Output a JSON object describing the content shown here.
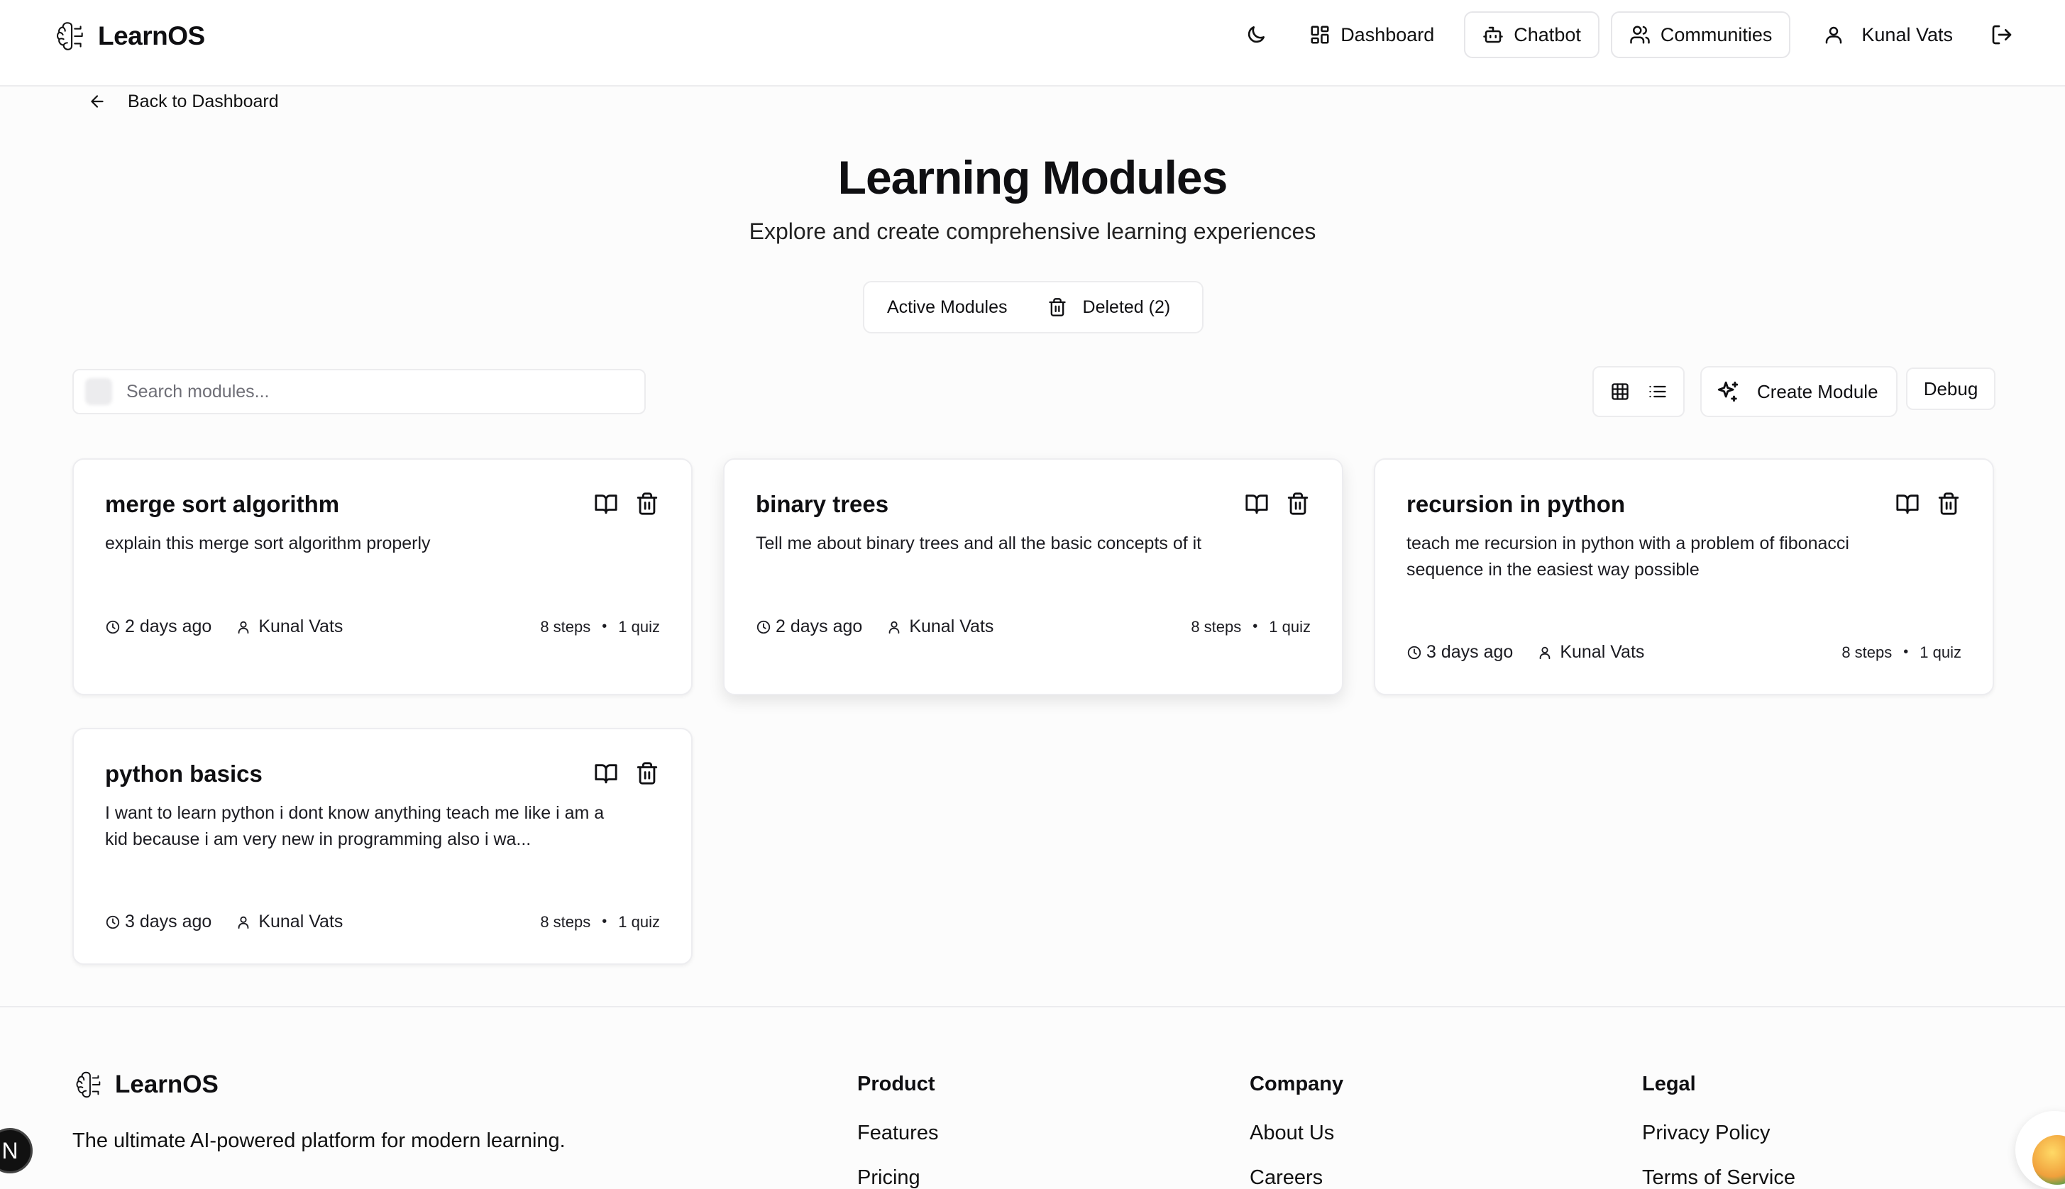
{
  "header": {
    "brand": "LearnOS",
    "nav": {
      "dashboard": "Dashboard",
      "chatbot": "Chatbot",
      "communities": "Communities",
      "user_name": "Kunal Vats"
    }
  },
  "back_link": "Back to Dashboard",
  "hero": {
    "title": "Learning Modules",
    "subtitle": "Explore and create comprehensive learning experiences"
  },
  "tabs": {
    "active": "Active Modules",
    "deleted": "Deleted (2)"
  },
  "toolbar": {
    "search_placeholder": "Search modules...",
    "create_label": "Create Module",
    "debug_label": "Debug"
  },
  "modules": [
    {
      "title": "merge sort algorithm",
      "description": "explain this merge sort algorithm properly",
      "time": "2 days ago",
      "author": "Kunal Vats",
      "steps": "8 steps",
      "quiz": "1 quiz"
    },
    {
      "title": "binary trees",
      "description": "Tell me about binary trees and all the basic concepts of it",
      "time": "2 days ago",
      "author": "Kunal Vats",
      "steps": "8 steps",
      "quiz": "1 quiz"
    },
    {
      "title": "recursion in python",
      "description": "teach me recursion in python with a problem of fibonacci sequence in the easiest way possible",
      "time": "3 days ago",
      "author": "Kunal Vats",
      "steps": "8 steps",
      "quiz": "1 quiz"
    },
    {
      "title": "python basics",
      "description": "I want to learn python i dont know anything teach me like i am a kid because i am very new in programming also i wa...",
      "time": "3 days ago",
      "author": "Kunal Vats",
      "steps": "8 steps",
      "quiz": "1 quiz"
    }
  ],
  "meta_separator": "•",
  "footer": {
    "brand": "LearnOS",
    "tagline": "The ultimate AI-powered platform for modern learning.",
    "product": {
      "heading": "Product",
      "links": [
        "Features",
        "Pricing"
      ]
    },
    "company": {
      "heading": "Company",
      "links": [
        "About Us",
        "Careers"
      ]
    },
    "legal": {
      "heading": "Legal",
      "links": [
        "Privacy Policy",
        "Terms of Service"
      ]
    }
  },
  "next_badge": "N",
  "icons": {
    "theme_toggle": "moon-icon",
    "dashboard": "layout-grid-icon",
    "chatbot": "bot-icon",
    "communities": "users-icon",
    "user": "user-icon",
    "logout": "log-out-icon",
    "back": "arrow-left-icon",
    "deleted_tab": "trash-icon",
    "grid_view": "grid-icon",
    "list_view": "list-icon",
    "create": "sparkles-icon",
    "card_open": "book-open-icon",
    "card_delete": "trash-icon",
    "time": "clock-icon",
    "author": "user-icon"
  },
  "colors": {
    "background": "#fcfcfc",
    "text": "#0f0f12",
    "border": "#ececee"
  }
}
